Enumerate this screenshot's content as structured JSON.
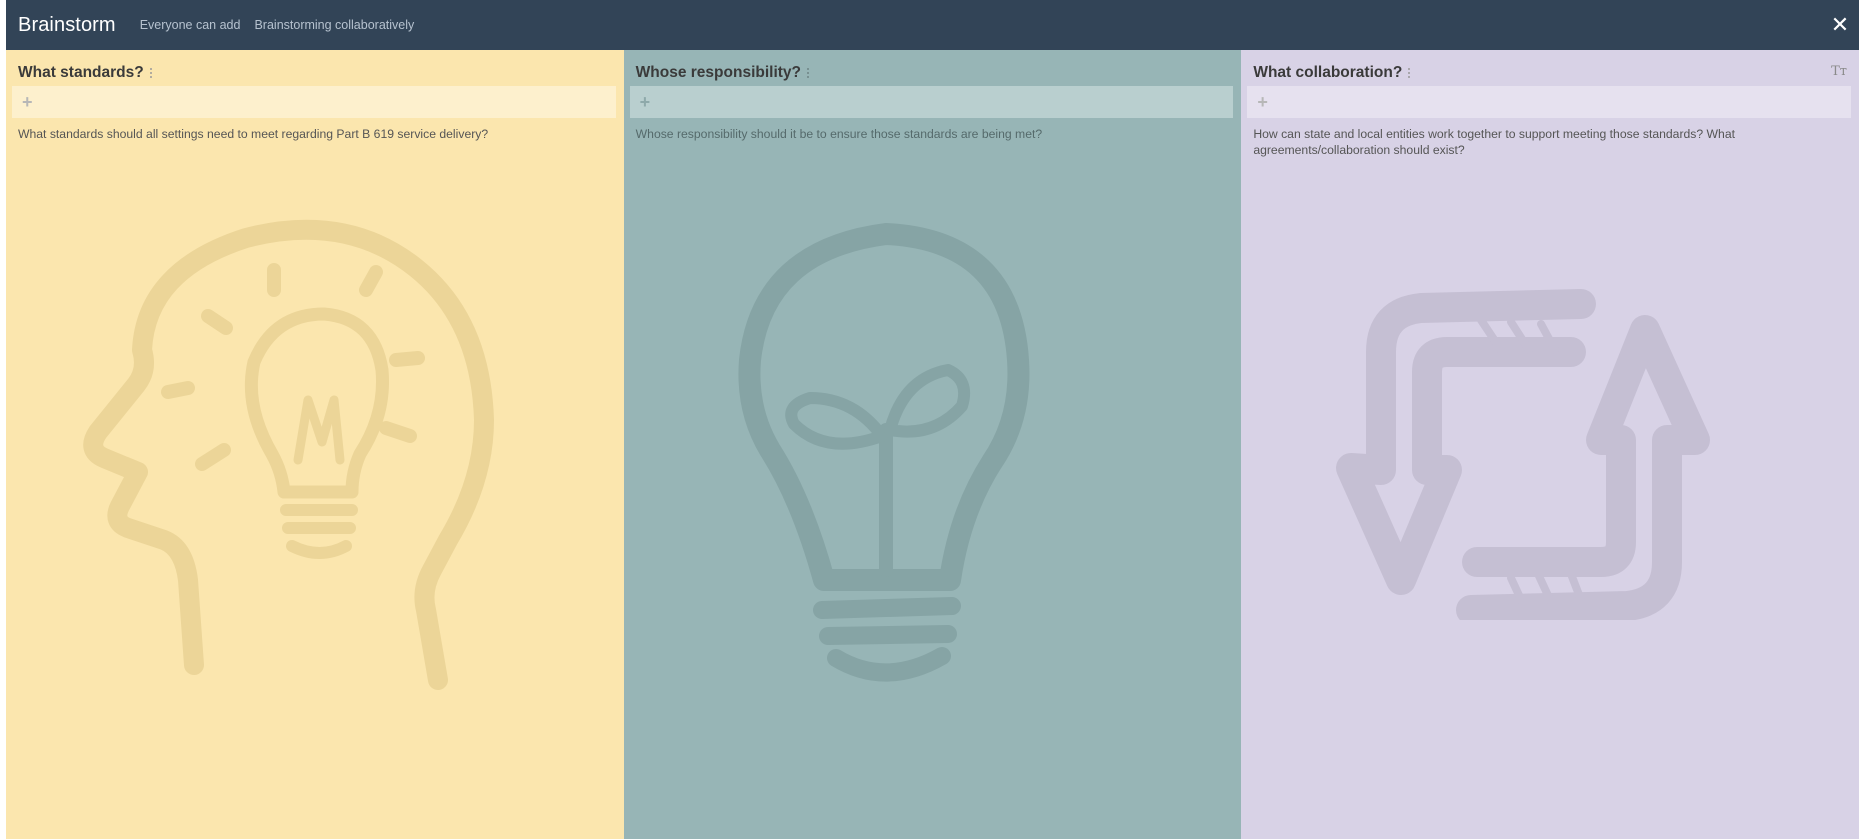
{
  "header": {
    "title": "Brainstorm",
    "subtitle": "Everyone can add",
    "description": "Brainstorming collaboratively",
    "close_symbol": "✕"
  },
  "columns": [
    {
      "title": "What standards?",
      "add_symbol": "+",
      "description": "What standards should all settings need to meet regarding Part B 619 service delivery?",
      "icon": "head-lightbulb-icon",
      "color": "#fbe6ae"
    },
    {
      "title": "Whose responsibility?",
      "add_symbol": "+",
      "description": "Whose responsibility should it be to ensure those standards are being met?",
      "icon": "lightbulb-sprout-icon",
      "color": "#97b5b6"
    },
    {
      "title": "What collaboration?",
      "add_symbol": "+",
      "description": "How can state and local entities work together to support meeting those standards? What agreements/collaboration should exist?",
      "icon": "cycle-arrows-icon",
      "color": "#d8d2e6",
      "text_size_symbol": "Tт"
    }
  ],
  "colors": {
    "header_bg": "#324457"
  }
}
